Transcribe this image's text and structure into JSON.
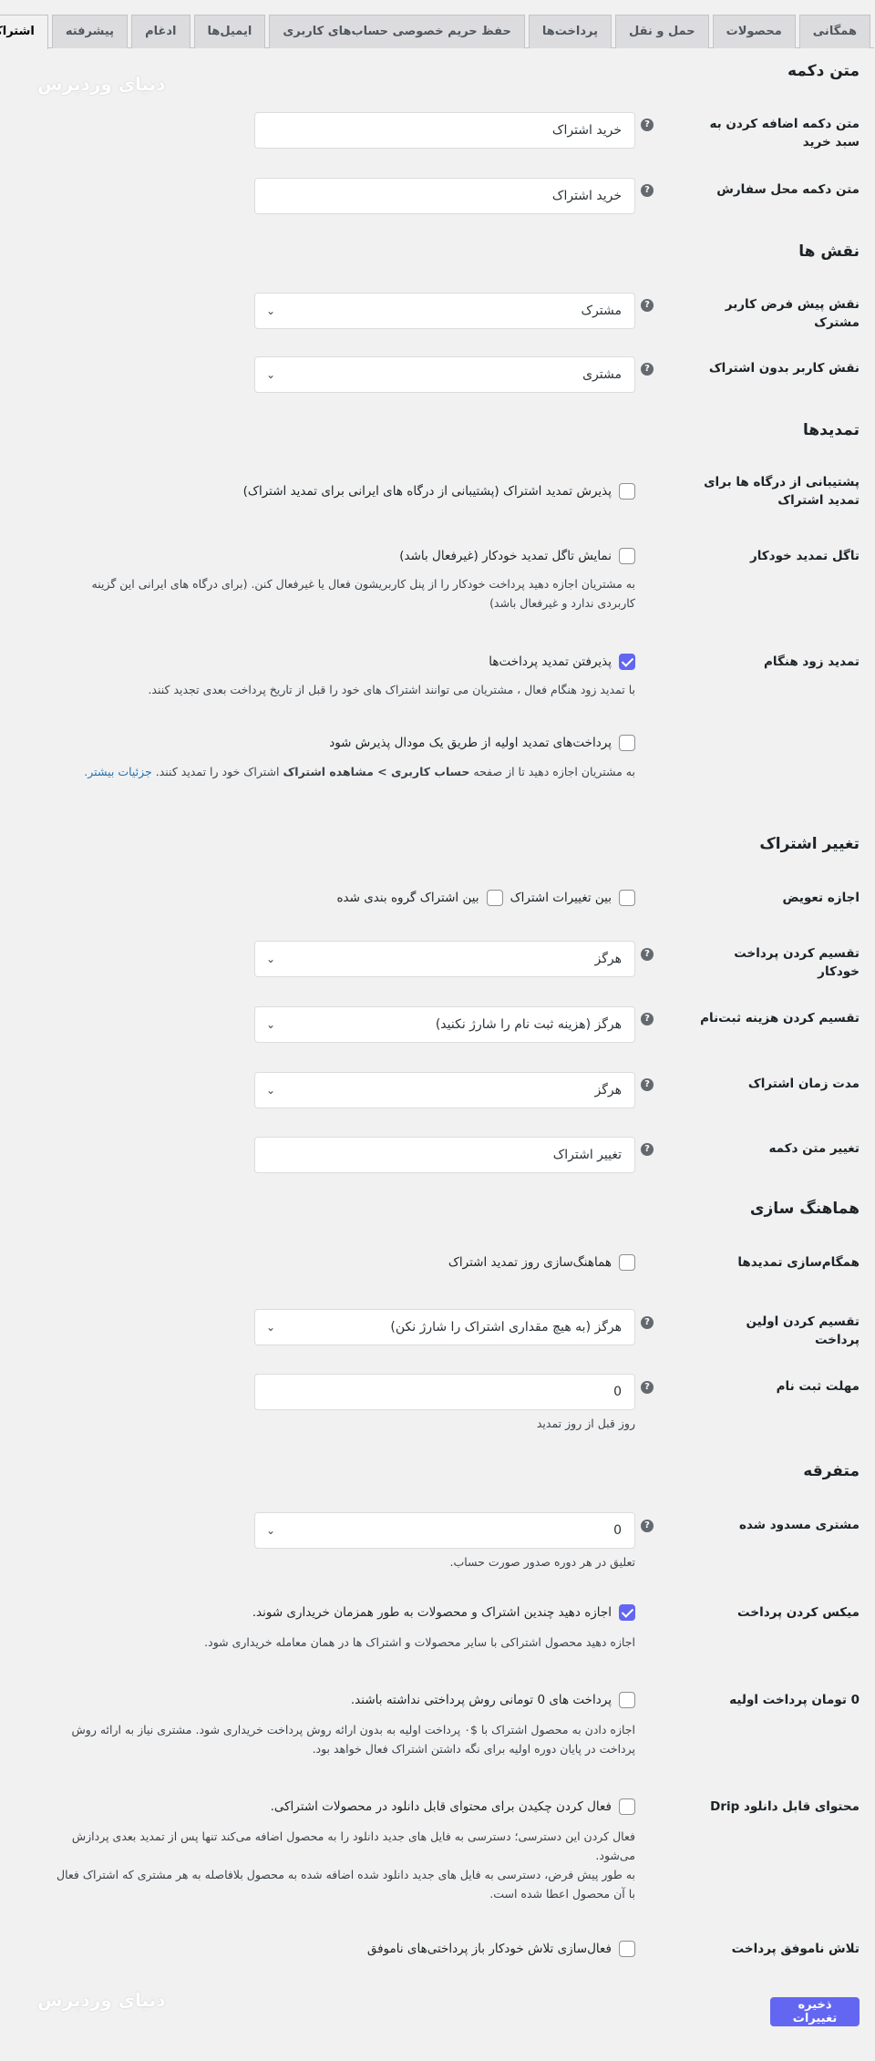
{
  "tabs": [
    "همگانی",
    "محصولات",
    "حمل و نقل",
    "پرداخت‌ها",
    "حفظ حریم خصوصی حساب‌های کاربری",
    "ایمیل‌ها",
    "ادغام",
    "پیشرفته",
    "اشتراک ها"
  ],
  "watermark": "دنیای وردپرس",
  "sections": {
    "button_text": "متن دکمه",
    "roles": "نقش ها",
    "renewals": "تمدیدها",
    "switching": "تغییر اشتراک",
    "sync": "هماهنگ سازی",
    "misc": "متفرقه"
  },
  "fields": {
    "add_to_cart_label": "متن دکمه اضافه کردن به سبد خرید",
    "add_to_cart_value": "خرید اشتراک",
    "place_order_label": "متن دکمه محل سفارش",
    "place_order_value": "خرید اشتراک",
    "default_role_label": "نقش پیش فرض کاربر مشترک",
    "default_role_value": "مشترک",
    "inactive_role_label": "نقش کاربر بدون اشتراک",
    "inactive_role_value": "مشتری",
    "gateway_support_label": "پشتیبانی از درگاه ها برای تمدید اشتراک",
    "gateway_support_text": "پذیرش تمدید اشتراک (پشتیبانی از درگاه های ایرانی برای تمدید اشتراک)",
    "auto_toggle_label": "تاگل تمدید خودکار",
    "auto_toggle_text": "نمایش تاگل تمدید خودکار (غیرفعال باشد)",
    "auto_toggle_desc": "به مشتریان اجازه دهید پرداخت خودکار را از پنل کاربریشون فعال یا غیرفعال کنن. (برای درگاه های ایرانی این گزینه کاربردی ندارد و غیرفعال باشد)",
    "early_renewal_label": "تمدید زود هنگام",
    "early_renewal_text": "پذیرفتن تمدید پرداخت‌ها",
    "early_renewal_desc": "با تمدید زود هنگام فعال ، مشتریان می توانند اشتراک های خود را قبل از تاریخ پرداخت بعدی تجدید کنند.",
    "early_modal_text": "پرداخت‌های تمدید اولیه از طریق یک مودال پذیرش شود",
    "early_modal_desc_1": "به مشتریان اجازه دهید تا از صفحه ",
    "early_modal_desc_bold": "حساب کاربری > مشاهده اشتراک",
    "early_modal_desc_2": " اشتراک خود را تمدید کنند. ",
    "early_modal_link": "جزئیات بیشتر.",
    "allow_switch_label": "اجازه تعویض",
    "switch_option_1": "بین تغییرات اشتراک",
    "switch_option_2": "بین اشتراک گروه بندی شده",
    "prorate_recurring_label": "تقسیم کردن پرداخت خودکار",
    "prorate_recurring_value": "هرگز",
    "prorate_signup_label": "تقسیم کردن هزینه ثبت‌نام",
    "prorate_signup_value": "هرگز (هزینه ثبت نام را شارژ نکنید)",
    "prorate_length_label": "مدت زمان اشتراک",
    "prorate_length_value": "هرگز",
    "switch_button_label": "تغییر متن دکمه",
    "switch_button_value": "تغییر اشتراک",
    "sync_renewals_label": "همگام‌سازی تمدیدها",
    "sync_renewals_text": "هماهنگ‌سازی روز تمدید اشتراک",
    "prorate_first_label": "تقسیم کردن اولین پرداخت",
    "prorate_first_value": "هرگز (به هیچ مقداری اشتراک را شارژ نکن)",
    "signup_grace_label": "مهلت ثبت نام",
    "signup_grace_value": "0",
    "signup_grace_desc": "روز قبل از روز تمدید",
    "suspensions_label": "مشتری مسدود شده",
    "suspensions_value": "0",
    "suspensions_desc": "تعلیق در هر دوره صدور صورت حساب.",
    "mixed_label": "میکس کردن پرداخت",
    "mixed_text": "اجازه دهید چندین اشتراک و محصولات به طور همزمان خریداری شوند.",
    "mixed_desc": "اجازه دهید محصول اشتراکی با سایر محصولات و اشتراک ها در همان معامله خریداری شود.",
    "zero_label": "0 تومان پرداخت اولیه",
    "zero_text": "پرداخت های 0 تومانی روش پرداختی نداشته باشند.",
    "zero_desc": "اجازه دادن به محصول اشتراک با $۰ پرداخت اولیه به بدون ارائه روش پرداخت خریداری شود. مشتری نیاز به ارائه روش پرداخت در پایان دوره اولیه برای نگه داشتن اشتراک فعال خواهد بود.",
    "drip_label": "محتوای قابل دانلود Drip",
    "drip_text": "فعال کردن چکیدن برای محتوای قابل دانلود در محصولات اشتراکی.",
    "drip_desc_1": "فعال کردن این دسترسی؛ دسترسی به فایل های جدید دانلود را به محصول اضافه می‌کند تنها پس از تمدید بعدی پردازش می‌شود.",
    "drip_desc_2": "به طور پیش فرض، دسترسی به فایل های جدید دانلود شده اضافه شده به محصول بلافاصله به هر مشتری که اشتراک فعال با آن محصول اعطا شده است.",
    "retry_label": "تلاش ناموفق پرداخت",
    "retry_text": "فعال‌سازی تلاش خودکار باز پرداختی‌های ناموفق"
  },
  "help_glyph": "?",
  "chevron_glyph": "⌄",
  "save_label": "ذخیره تغییرات",
  "colors": {
    "accent": "#6366f1",
    "link": "#2271b1",
    "background": "#f1f1f1"
  }
}
